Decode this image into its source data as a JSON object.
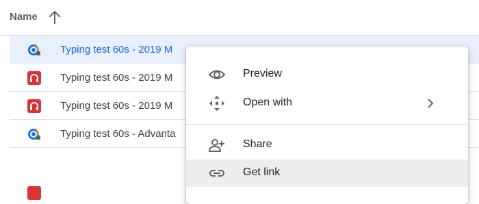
{
  "header": {
    "name_label": "Name",
    "sort_icon": "arrow-up-icon"
  },
  "files": [
    {
      "name": "Typing test 60s - 2019 M",
      "icon": "typing-app-icon",
      "selected": true
    },
    {
      "name": "Typing test 60s - 2019 M",
      "icon": "red-headphones-app-icon",
      "selected": false
    },
    {
      "name": "Typing test 60s - 2019 M",
      "icon": "red-headphones-app-icon",
      "selected": false
    },
    {
      "name": "Typing test 60s - Advanta",
      "icon": "typing-app-icon",
      "selected": false
    }
  ],
  "context_menu": {
    "items": [
      {
        "label": "Preview",
        "icon": "eye-icon"
      },
      {
        "label": "Open with",
        "icon": "move-arrows-icon",
        "submenu_icon": "chevron-right-icon"
      },
      {
        "label": "Share",
        "icon": "add-person-icon"
      },
      {
        "label": "Get link",
        "icon": "link-icon",
        "highlighted": true
      }
    ]
  },
  "colors": {
    "selected_row_bg": "#e8f0fe",
    "selected_text": "#1967d2",
    "hover_item_bg": "#eeeeee",
    "app_red": "#db3236",
    "app_blue": "#1a73e8"
  }
}
